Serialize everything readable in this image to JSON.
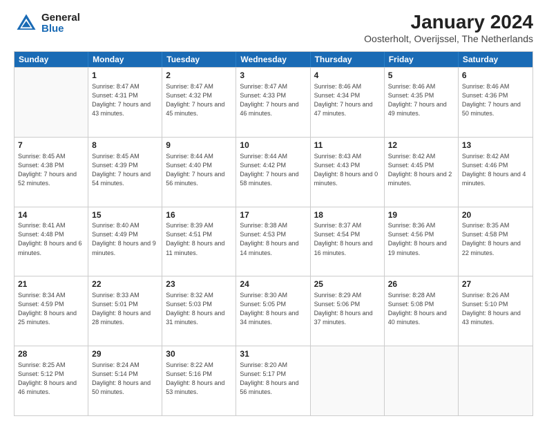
{
  "logo": {
    "general": "General",
    "blue": "Blue"
  },
  "title": "January 2024",
  "subtitle": "Oosterholt, Overijssel, The Netherlands",
  "days": [
    "Sunday",
    "Monday",
    "Tuesday",
    "Wednesday",
    "Thursday",
    "Friday",
    "Saturday"
  ],
  "weeks": [
    [
      {
        "day": "",
        "sunrise": "",
        "sunset": "",
        "daylight": ""
      },
      {
        "day": "1",
        "sunrise": "Sunrise: 8:47 AM",
        "sunset": "Sunset: 4:31 PM",
        "daylight": "Daylight: 7 hours and 43 minutes."
      },
      {
        "day": "2",
        "sunrise": "Sunrise: 8:47 AM",
        "sunset": "Sunset: 4:32 PM",
        "daylight": "Daylight: 7 hours and 45 minutes."
      },
      {
        "day": "3",
        "sunrise": "Sunrise: 8:47 AM",
        "sunset": "Sunset: 4:33 PM",
        "daylight": "Daylight: 7 hours and 46 minutes."
      },
      {
        "day": "4",
        "sunrise": "Sunrise: 8:46 AM",
        "sunset": "Sunset: 4:34 PM",
        "daylight": "Daylight: 7 hours and 47 minutes."
      },
      {
        "day": "5",
        "sunrise": "Sunrise: 8:46 AM",
        "sunset": "Sunset: 4:35 PM",
        "daylight": "Daylight: 7 hours and 49 minutes."
      },
      {
        "day": "6",
        "sunrise": "Sunrise: 8:46 AM",
        "sunset": "Sunset: 4:36 PM",
        "daylight": "Daylight: 7 hours and 50 minutes."
      }
    ],
    [
      {
        "day": "7",
        "sunrise": "Sunrise: 8:45 AM",
        "sunset": "Sunset: 4:38 PM",
        "daylight": "Daylight: 7 hours and 52 minutes."
      },
      {
        "day": "8",
        "sunrise": "Sunrise: 8:45 AM",
        "sunset": "Sunset: 4:39 PM",
        "daylight": "Daylight: 7 hours and 54 minutes."
      },
      {
        "day": "9",
        "sunrise": "Sunrise: 8:44 AM",
        "sunset": "Sunset: 4:40 PM",
        "daylight": "Daylight: 7 hours and 56 minutes."
      },
      {
        "day": "10",
        "sunrise": "Sunrise: 8:44 AM",
        "sunset": "Sunset: 4:42 PM",
        "daylight": "Daylight: 7 hours and 58 minutes."
      },
      {
        "day": "11",
        "sunrise": "Sunrise: 8:43 AM",
        "sunset": "Sunset: 4:43 PM",
        "daylight": "Daylight: 8 hours and 0 minutes."
      },
      {
        "day": "12",
        "sunrise": "Sunrise: 8:42 AM",
        "sunset": "Sunset: 4:45 PM",
        "daylight": "Daylight: 8 hours and 2 minutes."
      },
      {
        "day": "13",
        "sunrise": "Sunrise: 8:42 AM",
        "sunset": "Sunset: 4:46 PM",
        "daylight": "Daylight: 8 hours and 4 minutes."
      }
    ],
    [
      {
        "day": "14",
        "sunrise": "Sunrise: 8:41 AM",
        "sunset": "Sunset: 4:48 PM",
        "daylight": "Daylight: 8 hours and 6 minutes."
      },
      {
        "day": "15",
        "sunrise": "Sunrise: 8:40 AM",
        "sunset": "Sunset: 4:49 PM",
        "daylight": "Daylight: 8 hours and 9 minutes."
      },
      {
        "day": "16",
        "sunrise": "Sunrise: 8:39 AM",
        "sunset": "Sunset: 4:51 PM",
        "daylight": "Daylight: 8 hours and 11 minutes."
      },
      {
        "day": "17",
        "sunrise": "Sunrise: 8:38 AM",
        "sunset": "Sunset: 4:53 PM",
        "daylight": "Daylight: 8 hours and 14 minutes."
      },
      {
        "day": "18",
        "sunrise": "Sunrise: 8:37 AM",
        "sunset": "Sunset: 4:54 PM",
        "daylight": "Daylight: 8 hours and 16 minutes."
      },
      {
        "day": "19",
        "sunrise": "Sunrise: 8:36 AM",
        "sunset": "Sunset: 4:56 PM",
        "daylight": "Daylight: 8 hours and 19 minutes."
      },
      {
        "day": "20",
        "sunrise": "Sunrise: 8:35 AM",
        "sunset": "Sunset: 4:58 PM",
        "daylight": "Daylight: 8 hours and 22 minutes."
      }
    ],
    [
      {
        "day": "21",
        "sunrise": "Sunrise: 8:34 AM",
        "sunset": "Sunset: 4:59 PM",
        "daylight": "Daylight: 8 hours and 25 minutes."
      },
      {
        "day": "22",
        "sunrise": "Sunrise: 8:33 AM",
        "sunset": "Sunset: 5:01 PM",
        "daylight": "Daylight: 8 hours and 28 minutes."
      },
      {
        "day": "23",
        "sunrise": "Sunrise: 8:32 AM",
        "sunset": "Sunset: 5:03 PM",
        "daylight": "Daylight: 8 hours and 31 minutes."
      },
      {
        "day": "24",
        "sunrise": "Sunrise: 8:30 AM",
        "sunset": "Sunset: 5:05 PM",
        "daylight": "Daylight: 8 hours and 34 minutes."
      },
      {
        "day": "25",
        "sunrise": "Sunrise: 8:29 AM",
        "sunset": "Sunset: 5:06 PM",
        "daylight": "Daylight: 8 hours and 37 minutes."
      },
      {
        "day": "26",
        "sunrise": "Sunrise: 8:28 AM",
        "sunset": "Sunset: 5:08 PM",
        "daylight": "Daylight: 8 hours and 40 minutes."
      },
      {
        "day": "27",
        "sunrise": "Sunrise: 8:26 AM",
        "sunset": "Sunset: 5:10 PM",
        "daylight": "Daylight: 8 hours and 43 minutes."
      }
    ],
    [
      {
        "day": "28",
        "sunrise": "Sunrise: 8:25 AM",
        "sunset": "Sunset: 5:12 PM",
        "daylight": "Daylight: 8 hours and 46 minutes."
      },
      {
        "day": "29",
        "sunrise": "Sunrise: 8:24 AM",
        "sunset": "Sunset: 5:14 PM",
        "daylight": "Daylight: 8 hours and 50 minutes."
      },
      {
        "day": "30",
        "sunrise": "Sunrise: 8:22 AM",
        "sunset": "Sunset: 5:16 PM",
        "daylight": "Daylight: 8 hours and 53 minutes."
      },
      {
        "day": "31",
        "sunrise": "Sunrise: 8:20 AM",
        "sunset": "Sunset: 5:17 PM",
        "daylight": "Daylight: 8 hours and 56 minutes."
      },
      {
        "day": "",
        "sunrise": "",
        "sunset": "",
        "daylight": ""
      },
      {
        "day": "",
        "sunrise": "",
        "sunset": "",
        "daylight": ""
      },
      {
        "day": "",
        "sunrise": "",
        "sunset": "",
        "daylight": ""
      }
    ]
  ]
}
